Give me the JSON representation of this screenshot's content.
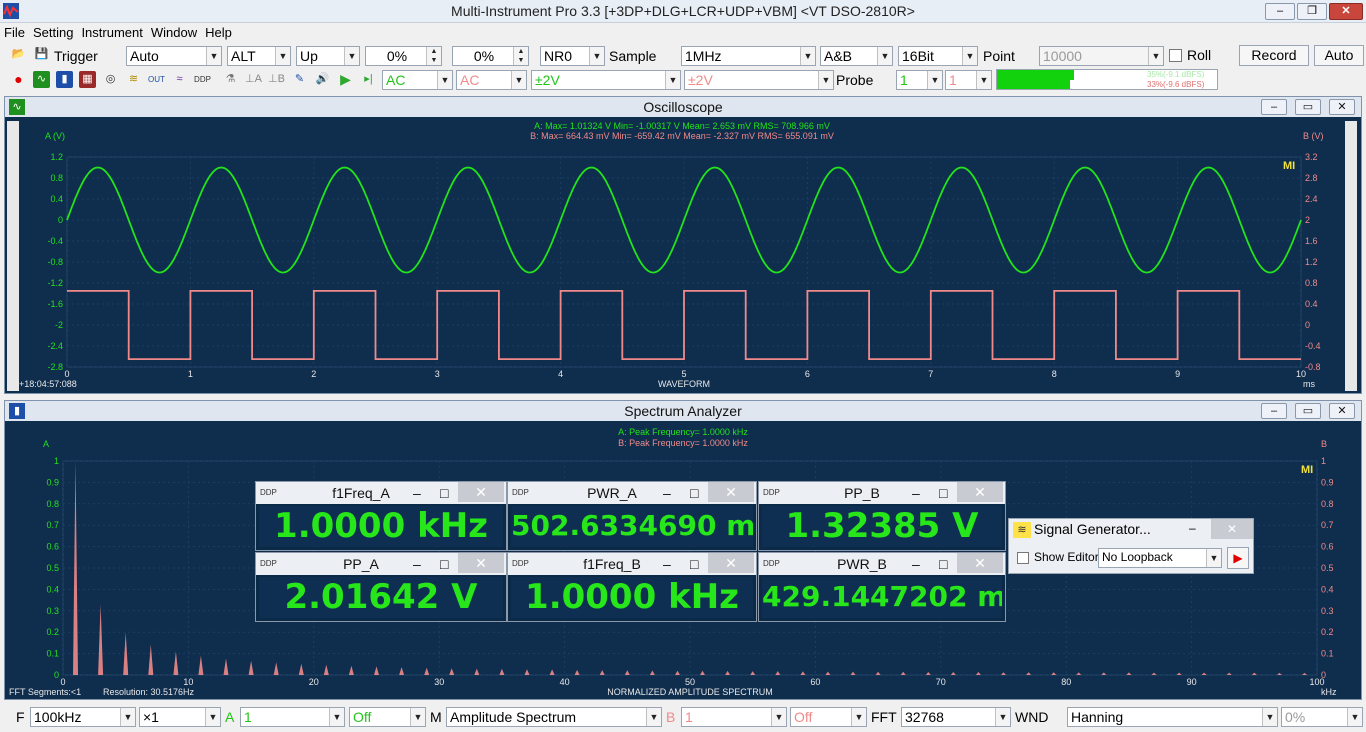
{
  "app": {
    "title": "Multi-Instrument Pro 3.3     [+3DP+DLG+LCR+UDP+VBM]     <VT DSO-2810R>"
  },
  "menu": [
    "File",
    "Setting",
    "Instrument",
    "Window",
    "Help"
  ],
  "toolbar1": {
    "trigger_label": "Trigger",
    "trigger_mode": "Auto",
    "trigger_source": "ALT",
    "trigger_edge": "Up",
    "trigger_level": "0%",
    "trigger_pos": "0%",
    "noise_reduction": "NR0",
    "sample_label": "Sample",
    "sample_rate": "1MHz",
    "channels": "A&B",
    "bits": "16Bit",
    "point_label": "Point",
    "point_value": "10000",
    "roll_label": "Roll",
    "record_label": "Record",
    "auto_label": "Auto"
  },
  "toolbar2": {
    "coupling_a": "AC",
    "coupling_b": "AC",
    "range_a": "±2V",
    "range_b": "±2V",
    "probe_label": "Probe",
    "probe_a": "1",
    "probe_b": "1",
    "level_a_text": "35%(-9.1 dBFS)",
    "level_b_text": "33%(-9.6 dBFS)",
    "level_a": 0.35,
    "level_b": 0.33
  },
  "oscilloscope": {
    "title": "Oscilloscope",
    "stats_a": "A: Max=   1.01324   V  Min=  -1.00317   V  Mean=       2.653  mV  RMS=     708.966  mV",
    "stats_b": "B: Max=     664.43  mV  Min=    -659.42  mV  Mean=      -2.327  mV  RMS=     655.091  mV",
    "axis_a_label": "A (V)",
    "axis_b_label": "B (V)",
    "y_left_ticks": [
      "1.2",
      "0.8",
      "0.4",
      "0",
      "-0.4",
      "-0.8",
      "-1.2",
      "-1.6",
      "-2",
      "-2.4",
      "-2.8"
    ],
    "y_right_ticks": [
      "3.2",
      "2.8",
      "2.4",
      "2",
      "1.6",
      "1.2",
      "0.8",
      "0.4",
      "0",
      "-0.4",
      "-0.8"
    ],
    "x_ticks": [
      "0",
      "1",
      "2",
      "3",
      "4",
      "5",
      "6",
      "7",
      "8",
      "9",
      "10"
    ],
    "x_unit": "ms",
    "x_caption": "WAVEFORM",
    "timestamp": "+18:04:57:088",
    "logo": "MI",
    "color_a": "#22e41a",
    "color_b": "#f08a8a"
  },
  "spectrum": {
    "title": "Spectrum Analyzer",
    "peak_a": "A: Peak Frequency=       1.0000   kHz",
    "peak_b": "B: Peak Frequency=       1.0000   kHz",
    "axis_a_label": "A",
    "axis_b_label": "B",
    "y_ticks": [
      "1",
      "0.9",
      "0.8",
      "0.7",
      "0.6",
      "0.5",
      "0.4",
      "0.3",
      "0.2",
      "0.1",
      "0"
    ],
    "x_ticks": [
      "0",
      "10",
      "20",
      "30",
      "40",
      "50",
      "60",
      "70",
      "80",
      "90",
      "100"
    ],
    "x_unit": "kHz",
    "x_caption": "NORMALIZED AMPLITUDE SPECTRUM",
    "segments": "FFT  Segments:<1",
    "resolution": "Resolution:  30.5176Hz",
    "logo": "MI"
  },
  "meters": [
    {
      "title": "f1Freq_A",
      "value": "1.0000 kHz"
    },
    {
      "title": "PWR_A",
      "value": "502.6334690 mW"
    },
    {
      "title": "PP_B",
      "value": "1.32385 V"
    },
    {
      "title": "PP_A",
      "value": "2.01642 V"
    },
    {
      "title": "f1Freq_B",
      "value": "1.0000 kHz"
    },
    {
      "title": "PWR_B",
      "value": "429.1447202 mW"
    }
  ],
  "signal_generator": {
    "title": "Signal Generator...",
    "show_editor": "Show Editor",
    "loopback": "No Loopback"
  },
  "bottom": {
    "f_label": "F",
    "f_value": "100kHz",
    "zoom": "×1",
    "a_label": "A",
    "a_value": "1",
    "a_off": "Off",
    "m_label": "M",
    "mode": "Amplitude Spectrum",
    "b_label": "B",
    "b_value": "1",
    "b_off": "Off",
    "fft_label": "FFT",
    "fft_size": "32768",
    "wnd_label": "WND",
    "window": "Hanning",
    "overlap": "0%"
  },
  "chart_data": [
    {
      "type": "line",
      "title": "Oscilloscope",
      "xlabel": "WAVEFORM",
      "x_unit": "ms",
      "xlim": [
        0,
        10
      ],
      "series": [
        {
          "name": "A",
          "shape": "sine",
          "frequency_khz": 1.0,
          "amplitude_v": 1.0,
          "offset_v": 0,
          "ylim": [
            -2.8,
            1.2
          ]
        },
        {
          "name": "B",
          "shape": "square",
          "frequency_khz": 1.0,
          "high_v": 0.65,
          "low_v": -0.65,
          "ylim": [
            -0.8,
            3.2
          ]
        }
      ]
    },
    {
      "type": "bar",
      "title": "Spectrum Analyzer",
      "xlabel": "NORMALIZED AMPLITUDE SPECTRUM",
      "x_unit": "kHz",
      "xlim": [
        0,
        100
      ],
      "ylim": [
        0,
        1
      ],
      "series": [
        {
          "name": "B",
          "x": [
            1,
            3,
            5,
            7,
            9,
            11,
            13,
            15,
            17,
            19,
            21,
            23,
            25,
            27,
            29,
            31,
            33,
            35,
            37,
            39,
            41,
            43,
            45,
            47,
            49,
            51,
            53,
            55,
            57,
            59,
            61,
            63,
            65,
            67,
            69,
            71,
            73,
            75,
            77,
            79,
            81,
            83,
            85,
            87,
            89,
            91,
            93,
            95,
            97,
            99
          ],
          "values": [
            1,
            0.33,
            0.2,
            0.143,
            0.111,
            0.091,
            0.077,
            0.067,
            0.059,
            0.053,
            0.048,
            0.043,
            0.04,
            0.037,
            0.034,
            0.032,
            0.03,
            0.029,
            0.027,
            0.026,
            0.024,
            0.023,
            0.022,
            0.021,
            0.02,
            0.02,
            0.019,
            0.018,
            0.018,
            0.017,
            0.016,
            0.016,
            0.015,
            0.015,
            0.014,
            0.014,
            0.014,
            0.013,
            0.013,
            0.013,
            0.012,
            0.012,
            0.012,
            0.011,
            0.011,
            0.011,
            0.011,
            0.011,
            0.01,
            0.01
          ]
        }
      ]
    }
  ]
}
